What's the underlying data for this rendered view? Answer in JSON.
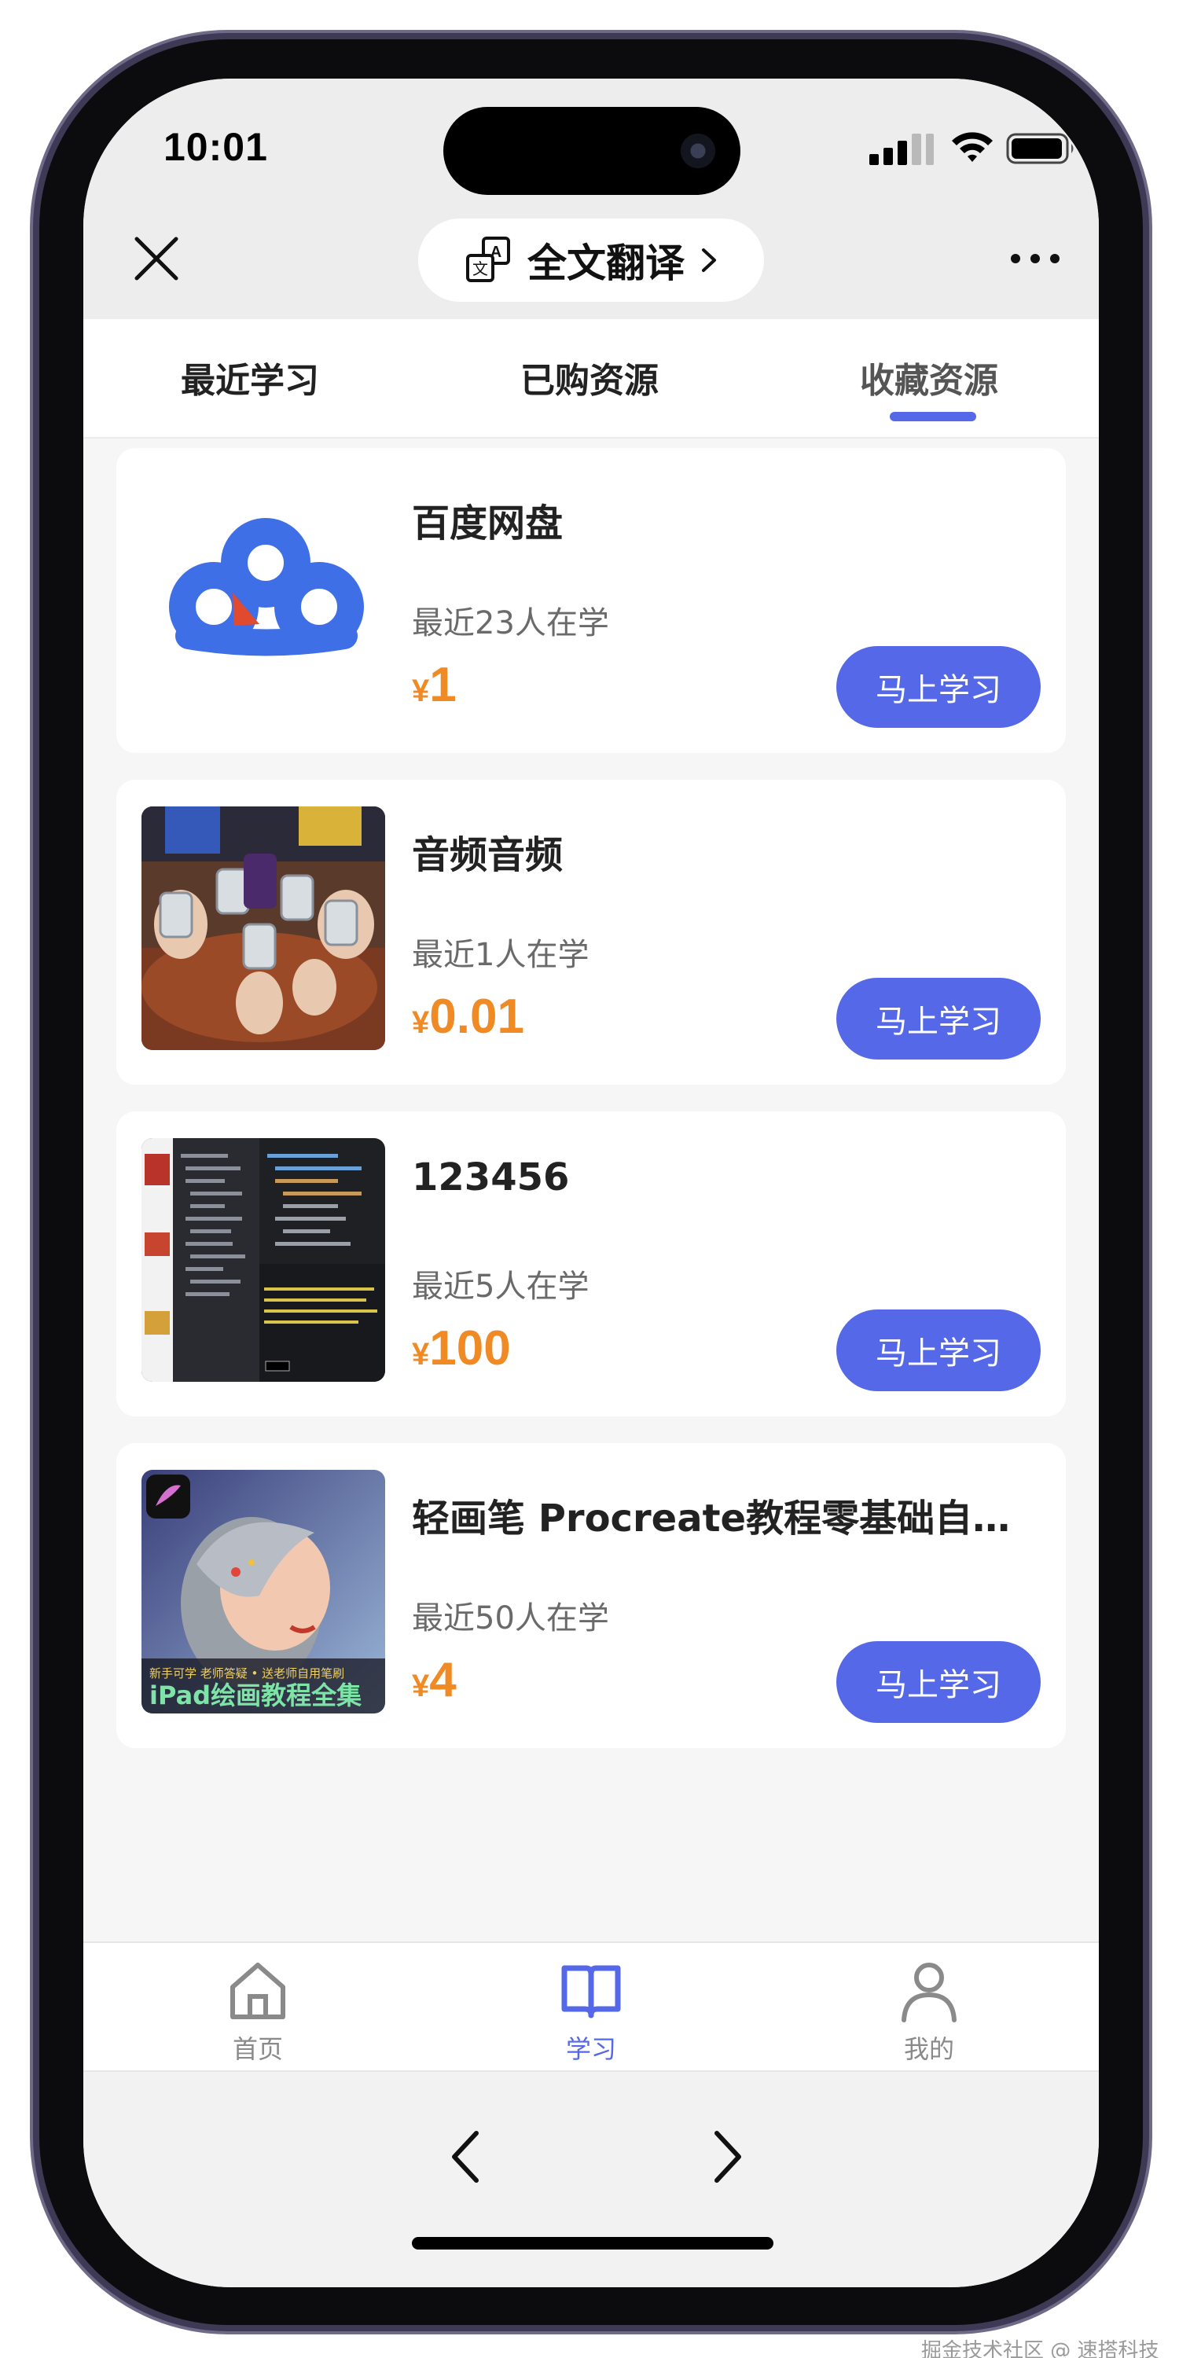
{
  "status_bar": {
    "time": "10:01"
  },
  "nav": {
    "translate_label": "全文翻译"
  },
  "tabs": [
    {
      "label": "最近学习"
    },
    {
      "label": "已购资源"
    },
    {
      "label": "收藏资源",
      "active": true
    }
  ],
  "courses": [
    {
      "title": "百度网盘",
      "learners": "最近23人在学",
      "currency": "¥",
      "price": "1",
      "button": "马上学习"
    },
    {
      "title": "音频音频",
      "learners": "最近1人在学",
      "currency": "¥",
      "price": "0.01",
      "button": "马上学习"
    },
    {
      "title": "123456",
      "learners": "最近5人在学",
      "currency": "¥",
      "price": "100",
      "button": "马上学习"
    },
    {
      "title": "轻画笔 Procreate教程零基础自学iPad绘画",
      "learners": "最近50人在学",
      "currency": "¥",
      "price": "4",
      "button": "马上学习"
    }
  ],
  "thumb4": {
    "line1": "新手可学 老师答疑 • 送老师自用笔刷",
    "line2": "iPad绘画教程全集"
  },
  "tabbar": [
    {
      "label": "首页",
      "icon": "home-icon"
    },
    {
      "label": "学习",
      "icon": "book-icon",
      "active": true
    },
    {
      "label": "我的",
      "icon": "user-icon"
    }
  ],
  "watermark": "掘金技术社区 @ 速搭科技",
  "colors": {
    "accent": "#5468e8",
    "price": "#f08a24",
    "background": "#f6f6f6"
  }
}
